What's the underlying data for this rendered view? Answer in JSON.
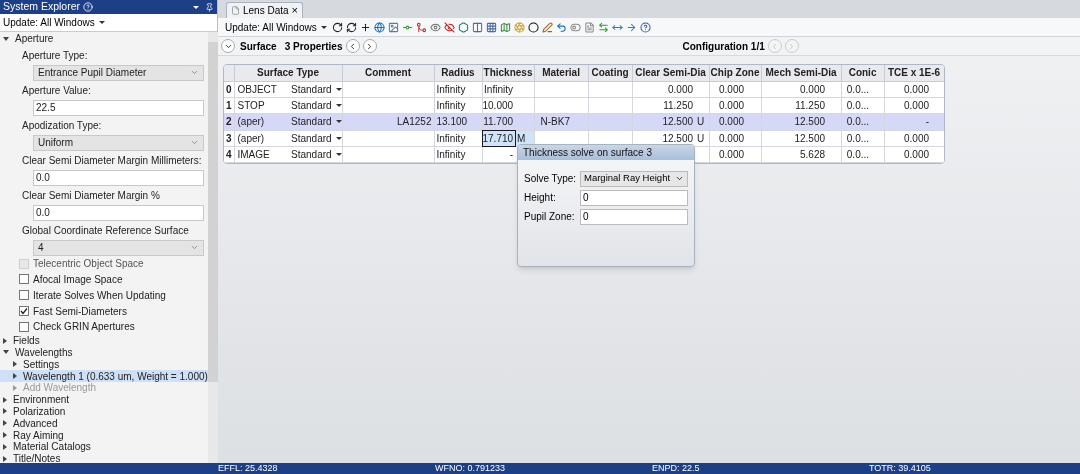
{
  "explorer": {
    "title": "System Explorer",
    "update": "Update: All Windows",
    "tree": [
      {
        "label": "Aperture",
        "expanded": true,
        "properties": [
          {
            "kind": "select",
            "label": "Aperture Type:",
            "value": "Entrance Pupil Diameter"
          },
          {
            "kind": "input",
            "label": "Aperture Value:",
            "value": "22.5"
          },
          {
            "kind": "select",
            "label": "Apodization Type:",
            "value": "Uniform"
          },
          {
            "kind": "input",
            "label": "Clear Semi Diameter Margin Millimeters:",
            "value": "0.0"
          },
          {
            "kind": "input",
            "label": "Clear Semi Diameter Margin %",
            "value": "0.0"
          },
          {
            "kind": "select",
            "label": "Global Coordinate Reference Surface",
            "value": "4"
          },
          {
            "kind": "checkbox",
            "label": "Telecentric Object Space",
            "checked": false,
            "disabled": true
          },
          {
            "kind": "checkbox",
            "label": "Afocal Image Space",
            "checked": false,
            "disabled": false
          },
          {
            "kind": "checkbox",
            "label": "Iterate Solves When Updating",
            "checked": false,
            "disabled": false
          },
          {
            "kind": "checkbox",
            "label": "Fast Semi-Diameters",
            "checked": true,
            "disabled": false
          },
          {
            "kind": "checkbox",
            "label": "Check GRIN Apertures",
            "checked": false,
            "disabled": false
          }
        ]
      },
      {
        "label": "Fields",
        "expanded": false
      },
      {
        "label": "Wavelengths",
        "expanded": true,
        "children": [
          {
            "label": "Settings",
            "expanded": false,
            "selected": false,
            "disabled": false
          },
          {
            "label": "Wavelength 1 (0.633 um, Weight = 1.000)",
            "expanded": false,
            "selected": true,
            "disabled": false
          },
          {
            "label": "Add Wavelength",
            "expanded": false,
            "selected": false,
            "disabled": true
          }
        ]
      },
      {
        "label": "Environment",
        "expanded": false
      },
      {
        "label": "Polarization",
        "expanded": false
      },
      {
        "label": "Advanced",
        "expanded": false
      },
      {
        "label": "Ray Aiming",
        "expanded": false
      },
      {
        "label": "Material Catalogs",
        "expanded": false
      },
      {
        "label": "Title/Notes",
        "expanded": false
      }
    ]
  },
  "tab": {
    "label": "Lens Data",
    "close": "×"
  },
  "toolbar": {
    "update": "Update: All Windows"
  },
  "surface_bar": {
    "label": "Surface",
    "properties": "3 Properties",
    "configuration": "Configuration 1/1"
  },
  "table": {
    "columns": [
      "Surface Type",
      "Comment",
      "Radius",
      "Thickness",
      "Material",
      "Coating",
      "Clear Semi-Dia",
      "Chip Zone",
      "Mech Semi-Dia",
      "Conic",
      "TCE x 1E-6"
    ],
    "rows": [
      {
        "index": "0",
        "surface": "OBJECT",
        "type": "Standard",
        "selected": false,
        "cells": {
          "radius": {
            "text": "Infinity",
            "focused": false
          },
          "thickness": {
            "text": "Infinity",
            "focused": false
          },
          "clear_semi_dia": {
            "text": "0.000",
            "focused": false
          },
          "chip_zone": {
            "text": "0.000",
            "focused": false
          },
          "mech_semi_dia": {
            "text": "0.000",
            "focused": false
          },
          "conic": {
            "text": "0.0...",
            "focused": false
          },
          "tce": {
            "text": "0.000",
            "focused": false
          }
        }
      },
      {
        "index": "1",
        "surface": "STOP",
        "type": "Standard",
        "selected": false,
        "cells": {
          "radius": {
            "text": "Infinity",
            "focused": false
          },
          "thickness": {
            "text": "10.000",
            "focused": false
          },
          "clear_semi_dia": {
            "text": "11.250",
            "focused": false
          },
          "chip_zone": {
            "text": "0.000",
            "focused": false
          },
          "mech_semi_dia": {
            "text": "11.250",
            "focused": false
          },
          "conic": {
            "text": "0.0...",
            "focused": false
          },
          "tce": {
            "text": "0.000",
            "focused": false
          }
        }
      },
      {
        "index": "2",
        "surface": "(aper)",
        "type": "Standard",
        "selected": true,
        "cells": {
          "comment": {
            "text": "LA1252",
            "focused": false
          },
          "radius": {
            "text": "13.100",
            "focused": false
          },
          "thickness": {
            "text": "11.700",
            "focused": false
          },
          "material": {
            "text": "N-BK7",
            "focused": false
          },
          "clear_semi_dia": {
            "text": "12.500",
            "solve": "U",
            "focused": false
          },
          "chip_zone": {
            "text": "0.000",
            "focused": false
          },
          "mech_semi_dia": {
            "text": "12.500",
            "focused": false
          },
          "conic": {
            "text": "0.0...",
            "focused": false
          },
          "tce": {
            "text": "-",
            "focused": false
          }
        }
      },
      {
        "index": "3",
        "surface": "(aper)",
        "type": "Standard",
        "selected": false,
        "cells": {
          "radius": {
            "text": "Infinity",
            "focused": false
          },
          "thickness": {
            "text": "17.710",
            "solve": "M",
            "focused": true
          },
          "clear_semi_dia": {
            "text": "12.500",
            "solve": "U",
            "focused": false
          },
          "chip_zone": {
            "text": "0.000",
            "focused": false
          },
          "mech_semi_dia": {
            "text": "12.500",
            "focused": false
          },
          "conic": {
            "text": "0.0...",
            "focused": false
          },
          "tce": {
            "text": "0.000",
            "focused": false
          }
        }
      },
      {
        "index": "4",
        "surface": "IMAGE",
        "type": "Standard",
        "selected": false,
        "cells": {
          "radius": {
            "text": "Infinity",
            "focused": false
          },
          "thickness": {
            "text": "-",
            "focused": false
          },
          "chip_zone": {
            "text": "0.000",
            "focused": false
          },
          "mech_semi_dia": {
            "text": "5.628",
            "focused": false
          },
          "conic": {
            "text": "0.0...",
            "focused": false
          },
          "tce": {
            "text": "0.000",
            "focused": false
          }
        }
      }
    ]
  },
  "solve_popup": {
    "title": "Thickness solve on surface 3",
    "fields": [
      {
        "kind": "select",
        "label": "Solve Type:",
        "value": "Marginal Ray Height"
      },
      {
        "kind": "input",
        "label": "Height:",
        "value": "0"
      },
      {
        "kind": "input",
        "label": "Pupil Zone:",
        "value": "0"
      }
    ]
  },
  "status_bar": [
    "EFFL: 25.4328",
    "WFNO: 0.791233",
    "ENPD: 22.5",
    "TOTR: 39.4105"
  ]
}
